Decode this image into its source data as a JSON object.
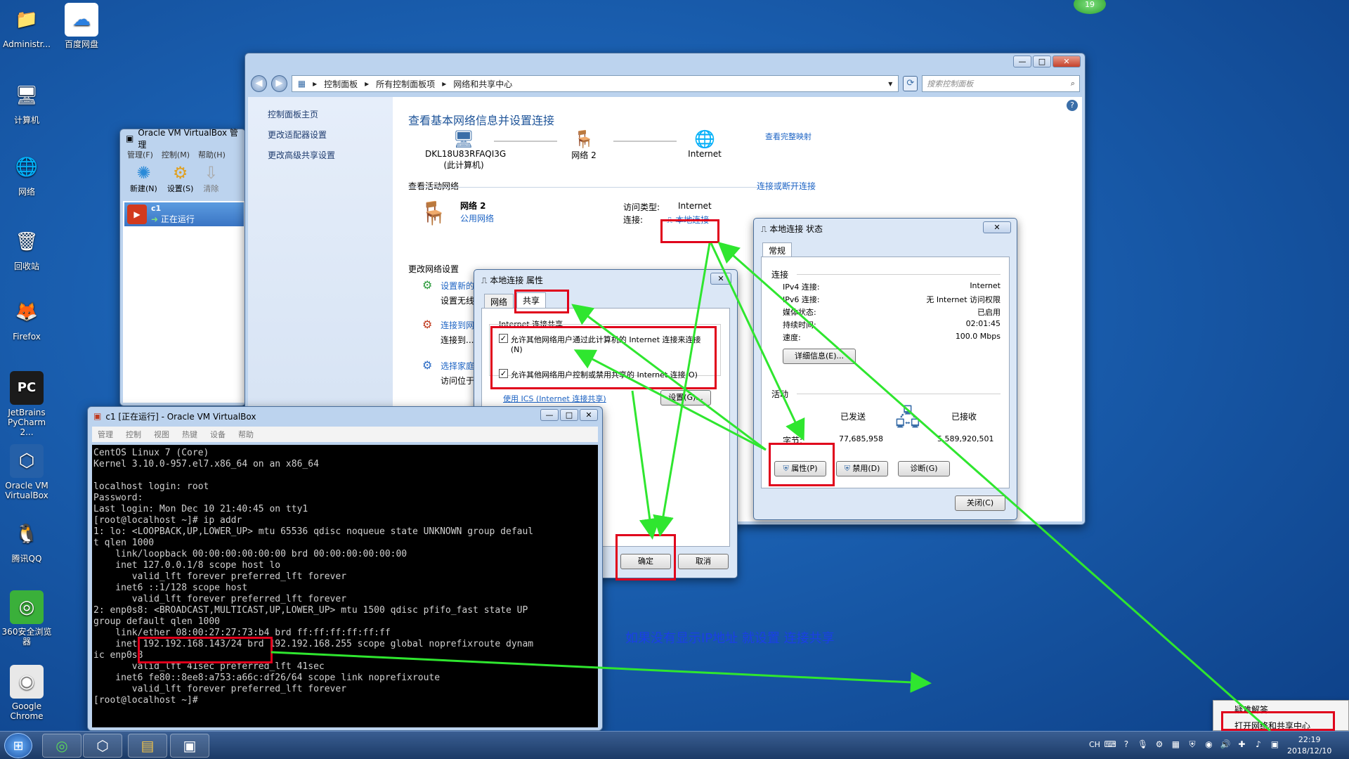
{
  "desktop": {
    "icons": [
      {
        "label": "Administr...",
        "icon": "user-folder-icon"
      },
      {
        "label": "百度网盘",
        "icon": "baidu-netdisk-icon"
      },
      {
        "label": "计算机",
        "icon": "computer-icon"
      },
      {
        "label": "网络",
        "icon": "network-icon"
      },
      {
        "label": "回收站",
        "icon": "recycle-bin-icon"
      },
      {
        "label": "Firefox",
        "icon": "firefox-icon"
      },
      {
        "label": "JetBrains PyCharm 2...",
        "icon": "pycharm-icon"
      },
      {
        "label": "Oracle VM VirtualBox",
        "icon": "virtualbox-icon"
      },
      {
        "label": "腾讯QQ",
        "icon": "qq-icon"
      },
      {
        "label": "360安全浏览器",
        "icon": "360-browser-icon"
      },
      {
        "label": "Google Chrome",
        "icon": "chrome-icon"
      }
    ],
    "badge": "19",
    "annotation": "如果没有显示IP地址  就设置  连接共享"
  },
  "control_panel": {
    "breadcrumb": [
      "控制面板",
      "所有控制面板项",
      "网络和共享中心"
    ],
    "search_placeholder": "搜索控制面板",
    "sidebar": [
      "控制面板主页",
      "更改适配器设置",
      "更改高级共享设置"
    ],
    "heading": "查看基本网络信息并设置连接",
    "view_full_map": "查看完整映射",
    "map_nodes": [
      {
        "name": "DKL18U83RFAQI3G",
        "sub": "(此计算机)"
      },
      {
        "name": "网络  2",
        "sub": ""
      },
      {
        "name": "Internet",
        "sub": ""
      }
    ],
    "active_networks_label": "查看活动网络",
    "connect_disconnect": "连接或断开连接",
    "network_name": "网络  2",
    "network_type": "公用网络",
    "access_type_label": "访问类型:",
    "access_type_value": "Internet",
    "connection_label": "连接:",
    "connection_value": "本地连接",
    "change_settings_label": "更改网络设置",
    "change_items": [
      {
        "link": "设置新的...",
        "desc": "设置无线..."
      },
      {
        "link": "连接到网络",
        "desc": "连接到..."
      },
      {
        "link": "选择家庭...",
        "desc": "访问位于..."
      }
    ]
  },
  "props_dialog": {
    "title": "本地连接 属性",
    "tabs": [
      "网络",
      "共享"
    ],
    "group_label": "Internet 连接共享",
    "opt1": "允许其他网络用户通过此计算机的 Internet 连接来连接(N)",
    "opt2": "允许其他网络用户控制或禁用共享的 Internet 连接(O)",
    "ics_link": "使用 ICS (Internet 连接共享)",
    "settings_btn": "设置(G)...",
    "ok_btn": "确定",
    "cancel_btn": "取消"
  },
  "status_dialog": {
    "title": "本地连接 状态",
    "tab": "常规",
    "connection_header": "连接",
    "rows": [
      {
        "k": "IPv4 连接:",
        "v": "Internet"
      },
      {
        "k": "IPv6 连接:",
        "v": "无 Internet 访问权限"
      },
      {
        "k": "媒体状态:",
        "v": "已启用"
      },
      {
        "k": "持续时间:",
        "v": "02:01:45"
      },
      {
        "k": "速度:",
        "v": "100.0 Mbps"
      }
    ],
    "details_btn": "详细信息(E)...",
    "activity_header": "活动",
    "sent_label": "已发送",
    "recv_label": "已接收",
    "bytes_label": "字节:",
    "bytes_sent": "77,685,958",
    "bytes_recv": "5,589,920,501",
    "props_btn": "属性(P)",
    "disable_btn": "禁用(D)",
    "diagnose_btn": "诊断(G)",
    "close_btn": "关闭(C)"
  },
  "vbox_manager": {
    "title": "Oracle VM VirtualBox 管理",
    "menu": [
      "管理(F)",
      "控制(M)",
      "帮助(H)"
    ],
    "tools": [
      "新建(N)",
      "设置(S)",
      "清除"
    ],
    "vm_name": "c1",
    "vm_state": "正在运行"
  },
  "vm_window": {
    "title": "c1 [正在运行] - Oracle VM VirtualBox",
    "menu": [
      "管理",
      "控制",
      "视图",
      "热键",
      "设备",
      "帮助"
    ],
    "terminal": "CentOS Linux 7 (Core)\nKernel 3.10.0-957.el7.x86_64 on an x86_64\n\nlocalhost login: root\nPassword:\nLast login: Mon Dec 10 21:40:45 on tty1\n[root@localhost ~]# ip addr\n1: lo: <LOOPBACK,UP,LOWER_UP> mtu 65536 qdisc noqueue state UNKNOWN group defaul\nt qlen 1000\n    link/loopback 00:00:00:00:00:00 brd 00:00:00:00:00:00\n    inet 127.0.0.1/8 scope host lo\n       valid_lft forever preferred_lft forever\n    inet6 ::1/128 scope host\n       valid_lft forever preferred_lft forever\n2: enp0s8: <BROADCAST,MULTICAST,UP,LOWER_UP> mtu 1500 qdisc pfifo_fast state UP\ngroup default qlen 1000\n    link/ether 08:00:27:27:73:b4 brd ff:ff:ff:ff:ff:ff\n    inet 192.192.168.143/24 brd 192.192.168.255 scope global noprefixroute dynam\nic enp0s8\n       valid_lft 41sec preferred_lft 41sec\n    inet6 fe80::8ee8:a753:a66c:df26/64 scope link noprefixroute\n       valid_lft forever preferred_lft forever\n[root@localhost ~]#"
  },
  "context_menu": {
    "items": [
      "疑难解答",
      "打开网络和共享中心"
    ]
  },
  "taskbar": {
    "lang": "CH",
    "time": "22:19",
    "date": "2018/12/10"
  }
}
